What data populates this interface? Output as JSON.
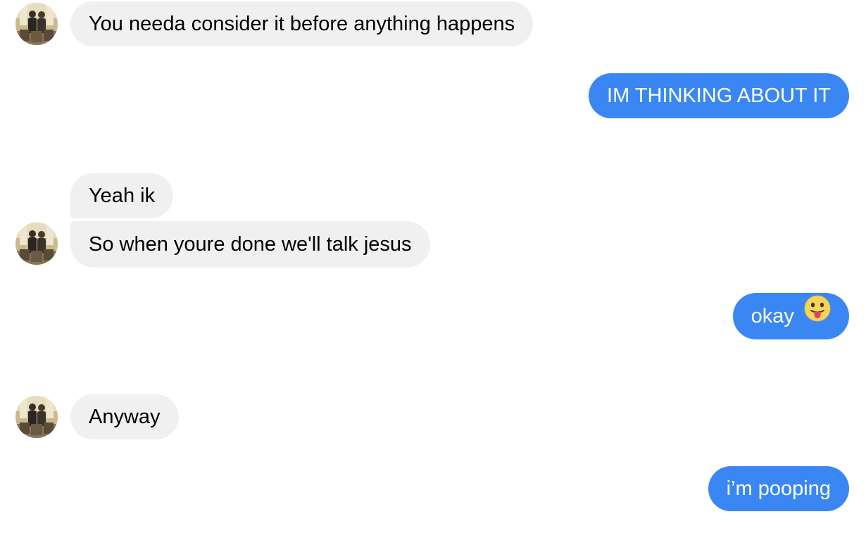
{
  "conversation": {
    "messages": [
      {
        "sender": "contact",
        "text": "You needa consider it before anything happens"
      },
      {
        "sender": "me",
        "text": "IM THINKING ABOUT IT"
      },
      {
        "sender": "contact",
        "text": "Yeah ik"
      },
      {
        "sender": "contact",
        "text": "So when youre done we'll talk jesus"
      },
      {
        "sender": "me",
        "text": "okay",
        "emoji": "face-with-tongue"
      },
      {
        "sender": "contact",
        "text": "Anyway"
      },
      {
        "sender": "me",
        "text": "i’m pooping"
      }
    ]
  },
  "colors": {
    "incoming_bubble": "#f0f0f0",
    "outgoing_bubble": "#3a87f3"
  },
  "icons": {
    "avatar": "contact-avatar",
    "emoji": "face-with-tongue-emoji"
  }
}
